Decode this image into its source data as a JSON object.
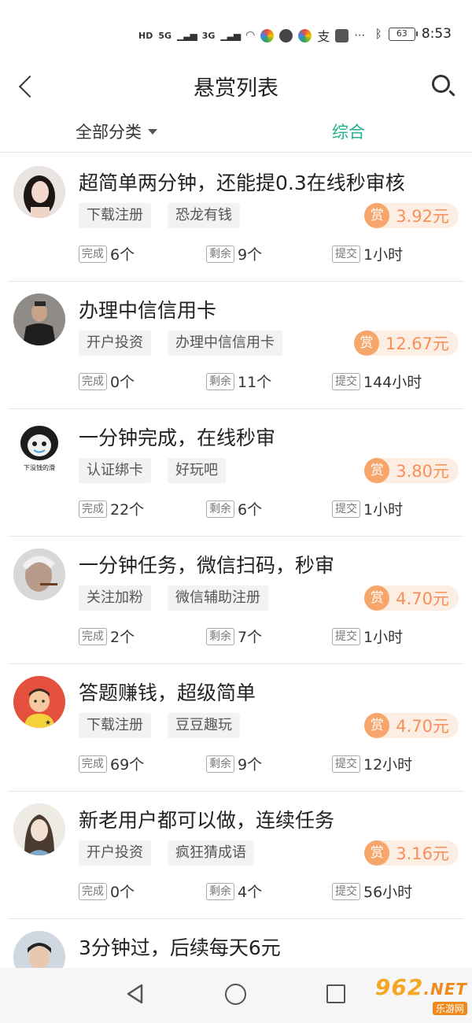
{
  "status_bar": {
    "indicators": [
      "HD",
      "5G",
      "3G"
    ],
    "battery": "63",
    "time": "8:53"
  },
  "header": {
    "title": "悬赏列表"
  },
  "filters": {
    "category": "全部分类",
    "sort": "综合"
  },
  "labels": {
    "done": "完成",
    "remaining": "剩余",
    "submit": "提交",
    "reward_badge": "赏"
  },
  "items": [
    {
      "title": "超简单两分钟，还能提0.3在线秒审核",
      "tag1": "下载注册",
      "tag2": "恐龙有钱",
      "reward": "3.92元",
      "done": "6个",
      "remaining": "9个",
      "submit": "1小时"
    },
    {
      "title": "办理中信信用卡",
      "tag1": "开户投资",
      "tag2": "办理中信信用卡",
      "reward": "12.67元",
      "done": "0个",
      "remaining": "11个",
      "submit": "144小时"
    },
    {
      "title": "一分钟完成，在线秒审",
      "tag1": "认证绑卡",
      "tag2": "好玩吧",
      "reward": "3.80元",
      "done": "22个",
      "remaining": "6个",
      "submit": "1小时",
      "avatar_caption": "下没钱的滑"
    },
    {
      "title": "一分钟任务，微信扫码，秒审",
      "tag1": "关注加粉",
      "tag2": "微信辅助注册",
      "reward": "4.70元",
      "done": "2个",
      "remaining": "7个",
      "submit": "1小时"
    },
    {
      "title": "答题赚钱，超级简单",
      "tag1": "下载注册",
      "tag2": "豆豆趣玩",
      "reward": "4.70元",
      "done": "69个",
      "remaining": "9个",
      "submit": "12小时"
    },
    {
      "title": "新老用户都可以做，连续任务",
      "tag1": "开户投资",
      "tag2": "疯狂猜成语",
      "reward": "3.16元",
      "done": "0个",
      "remaining": "4个",
      "submit": "56小时"
    },
    {
      "title": "3分钟过，后续每天6元"
    }
  ],
  "watermark": {
    "logo": "962",
    "net": ".NET",
    "sub": "乐游网"
  },
  "colors": {
    "accent": "#21b08b",
    "reward": "#f5905a",
    "reward_badge": "#f6a66b"
  }
}
